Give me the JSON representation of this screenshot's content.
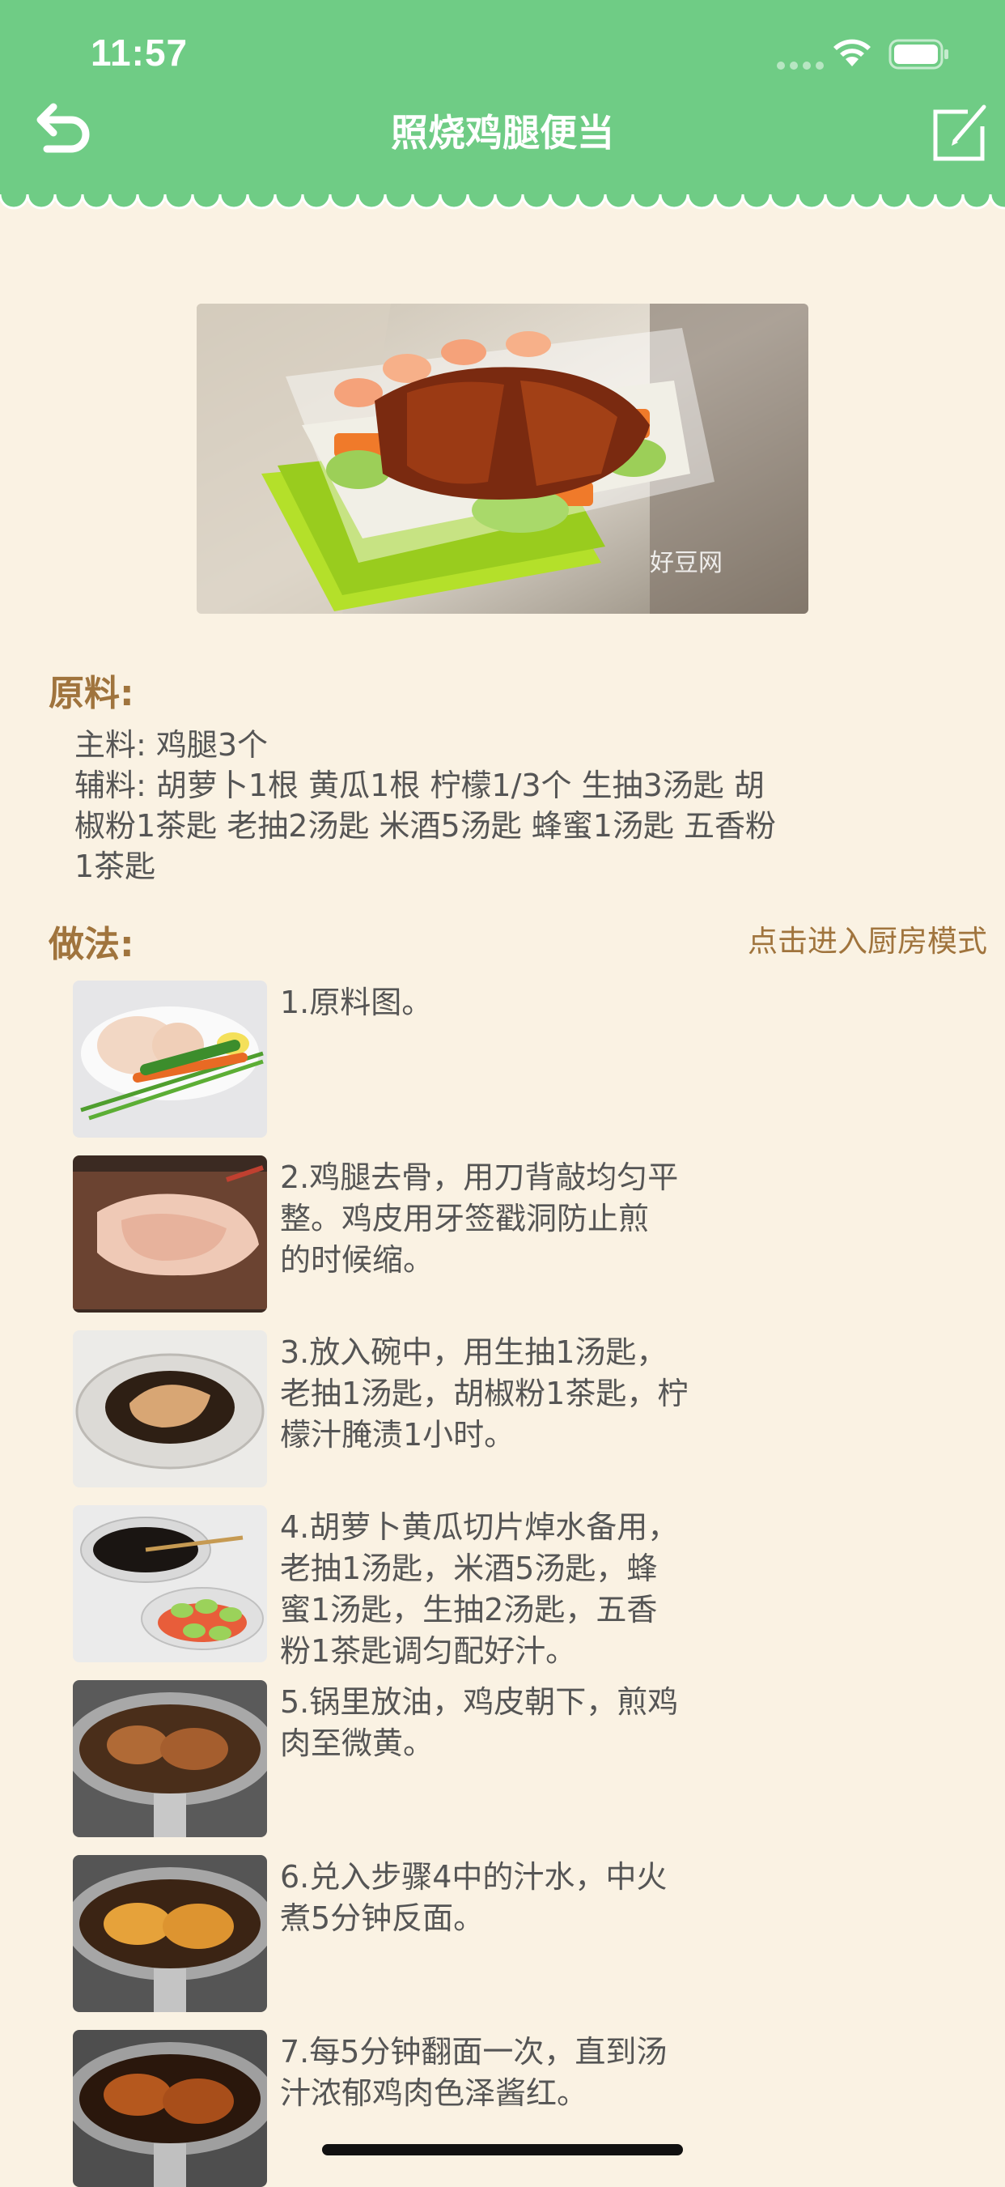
{
  "status_bar": {
    "time": "11:57"
  },
  "header": {
    "title": "照烧鸡腿便当",
    "back_icon": "back-arrow-icon",
    "edit_icon": "edit-icon",
    "background_color": "#6fcc85"
  },
  "hero_image": {
    "description_icon": "bento-photo",
    "watermark": "好豆网"
  },
  "ingredients": {
    "label": "原料:",
    "main": "主料: 鸡腿3个",
    "aux_lines": [
      "辅料: 胡萝卜1根  黄瓜1根  柠檬1/3个  生抽3汤匙  胡",
      "椒粉1茶匙  老抽2汤匙  米酒5汤匙  蜂蜜1汤匙  五香粉",
      "1茶匙"
    ]
  },
  "method": {
    "label": "做法:",
    "kitchen_mode_link": "点击进入厨房模式",
    "steps": [
      {
        "lines": [
          "1.原料图。"
        ]
      },
      {
        "lines": [
          "2.鸡腿去骨，用刀背敲均匀平",
          "整。鸡皮用牙签戳洞防止煎",
          "的时候缩。"
        ]
      },
      {
        "lines": [
          "3.放入碗中，用生抽1汤匙，",
          "老抽1汤匙，胡椒粉1茶匙，柠",
          "檬汁腌渍1小时。"
        ]
      },
      {
        "lines": [
          "4.胡萝卜黄瓜切片焯水备用，",
          "老抽1汤匙，米酒5汤匙，蜂",
          "蜜1汤匙，生抽2汤匙，五香",
          "粉1茶匙调匀配好汁。"
        ]
      },
      {
        "lines": [
          "5.锅里放油，鸡皮朝下，煎鸡",
          "肉至微黄。"
        ]
      },
      {
        "lines": [
          "6.兑入步骤4中的汁水，中火",
          "煮5分钟反面。"
        ]
      },
      {
        "lines": [
          "7.每5分钟翻面一次，直到汤",
          "汁浓郁鸡肉色泽酱红。"
        ]
      }
    ]
  },
  "colors": {
    "accent_brown": "#a0743d",
    "page_background": "#faf2e3"
  }
}
